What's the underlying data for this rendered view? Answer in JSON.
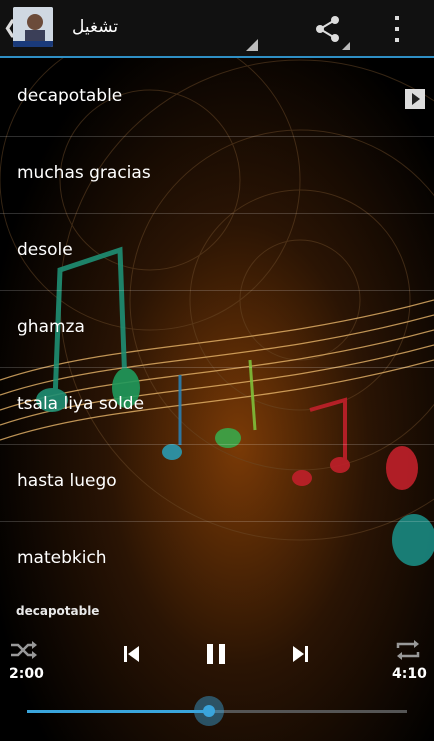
{
  "header": {
    "title": "تشغيل",
    "back_icon": "chevron-left-icon",
    "share_icon": "share-icon",
    "menu_icon": "overflow-menu-icon"
  },
  "tracks": [
    {
      "label": "decapotable",
      "playing": true
    },
    {
      "label": "muchas gracias"
    },
    {
      "label": "desole"
    },
    {
      "label": "ghamza"
    },
    {
      "label": "tsala liya solde"
    },
    {
      "label": "hasta luego"
    },
    {
      "label": "matebkich"
    }
  ],
  "player": {
    "now_playing": "decapotable",
    "elapsed": "2:00",
    "duration": "4:10",
    "progress": 0.48,
    "shuffle_icon": "shuffle-icon",
    "prev_icon": "skip-previous-icon",
    "pause_icon": "pause-icon",
    "next_icon": "skip-next-icon",
    "repeat_icon": "repeat-icon"
  },
  "colors": {
    "accent": "#3aa5dc",
    "actionbar": "#111111"
  }
}
